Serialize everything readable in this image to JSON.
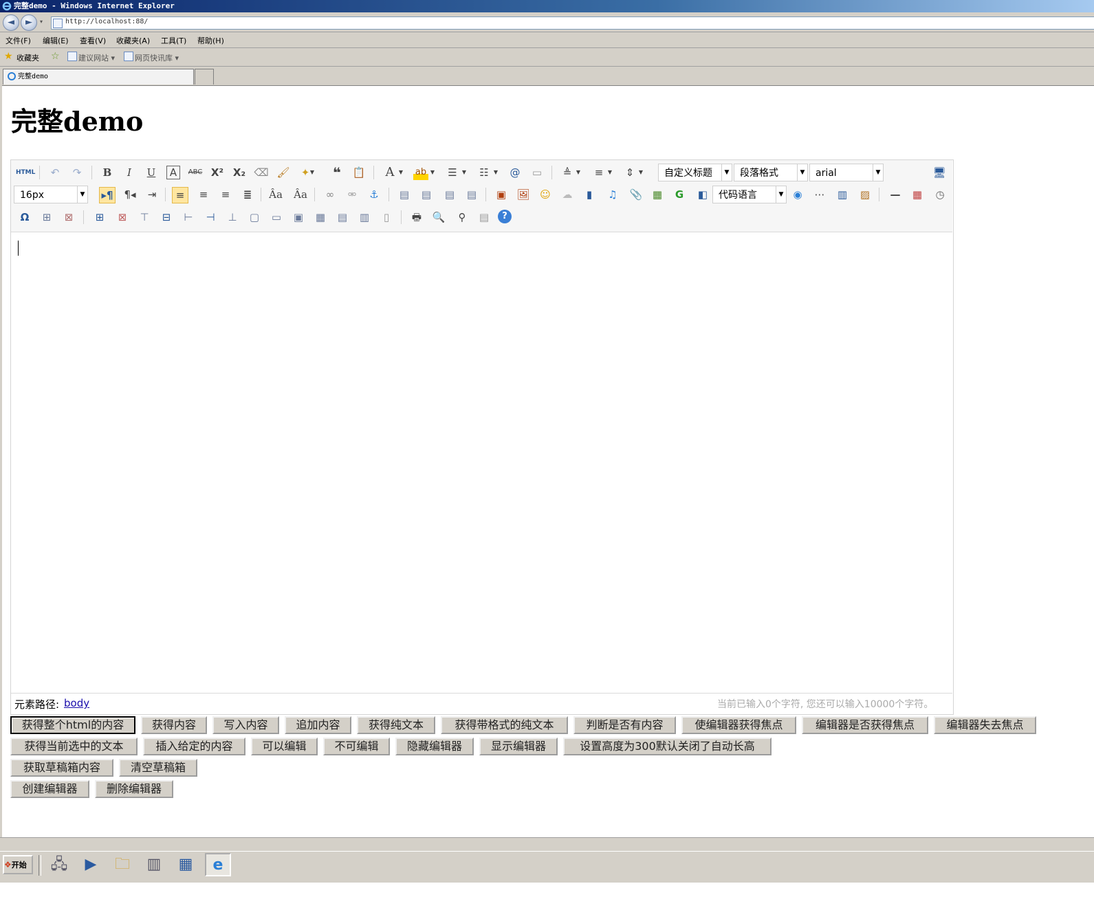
{
  "window": {
    "title": "完整demo - Windows Internet Explorer"
  },
  "address": {
    "url": "http://localhost:88/"
  },
  "menu": [
    "文件(F)",
    "编辑(E)",
    "查看(V)",
    "收藏夹(A)",
    "工具(T)",
    "帮助(H)"
  ],
  "favorites": {
    "label": "收藏夹",
    "suggested": "建议网站 ▾",
    "slices": "网页快讯库 ▾"
  },
  "tab": {
    "title": "完整demo"
  },
  "page": {
    "heading": "完整demo"
  },
  "toolbar": {
    "custom_title": "自定义标题",
    "paragraph": "段落格式",
    "font_family": "arial",
    "font_size": "16px",
    "code_language": "代码语言"
  },
  "statusbar": {
    "path_label": "元素路径:",
    "path_link": "body",
    "word_count": "当前已输入0个字符, 您还可以输入10000个字符。"
  },
  "buttons": {
    "row1": [
      "获得整个html的内容",
      "获得内容",
      "写入内容",
      "追加内容",
      "获得纯文本",
      "获得带格式的纯文本",
      "判断是否有内容",
      "使编辑器获得焦点",
      "编辑器是否获得焦点",
      "编辑器失去焦点"
    ],
    "row2": [
      "获得当前选中的文本",
      "插入给定的内容",
      "可以编辑",
      "不可编辑",
      "隐藏编辑器",
      "显示编辑器",
      "设置高度为300默认关闭了自动长高"
    ],
    "row3": [
      "获取草稿箱内容",
      "清空草稿箱"
    ],
    "row4": [
      "创建编辑器",
      "删除编辑器"
    ]
  },
  "taskbar": {
    "start": "开始"
  }
}
